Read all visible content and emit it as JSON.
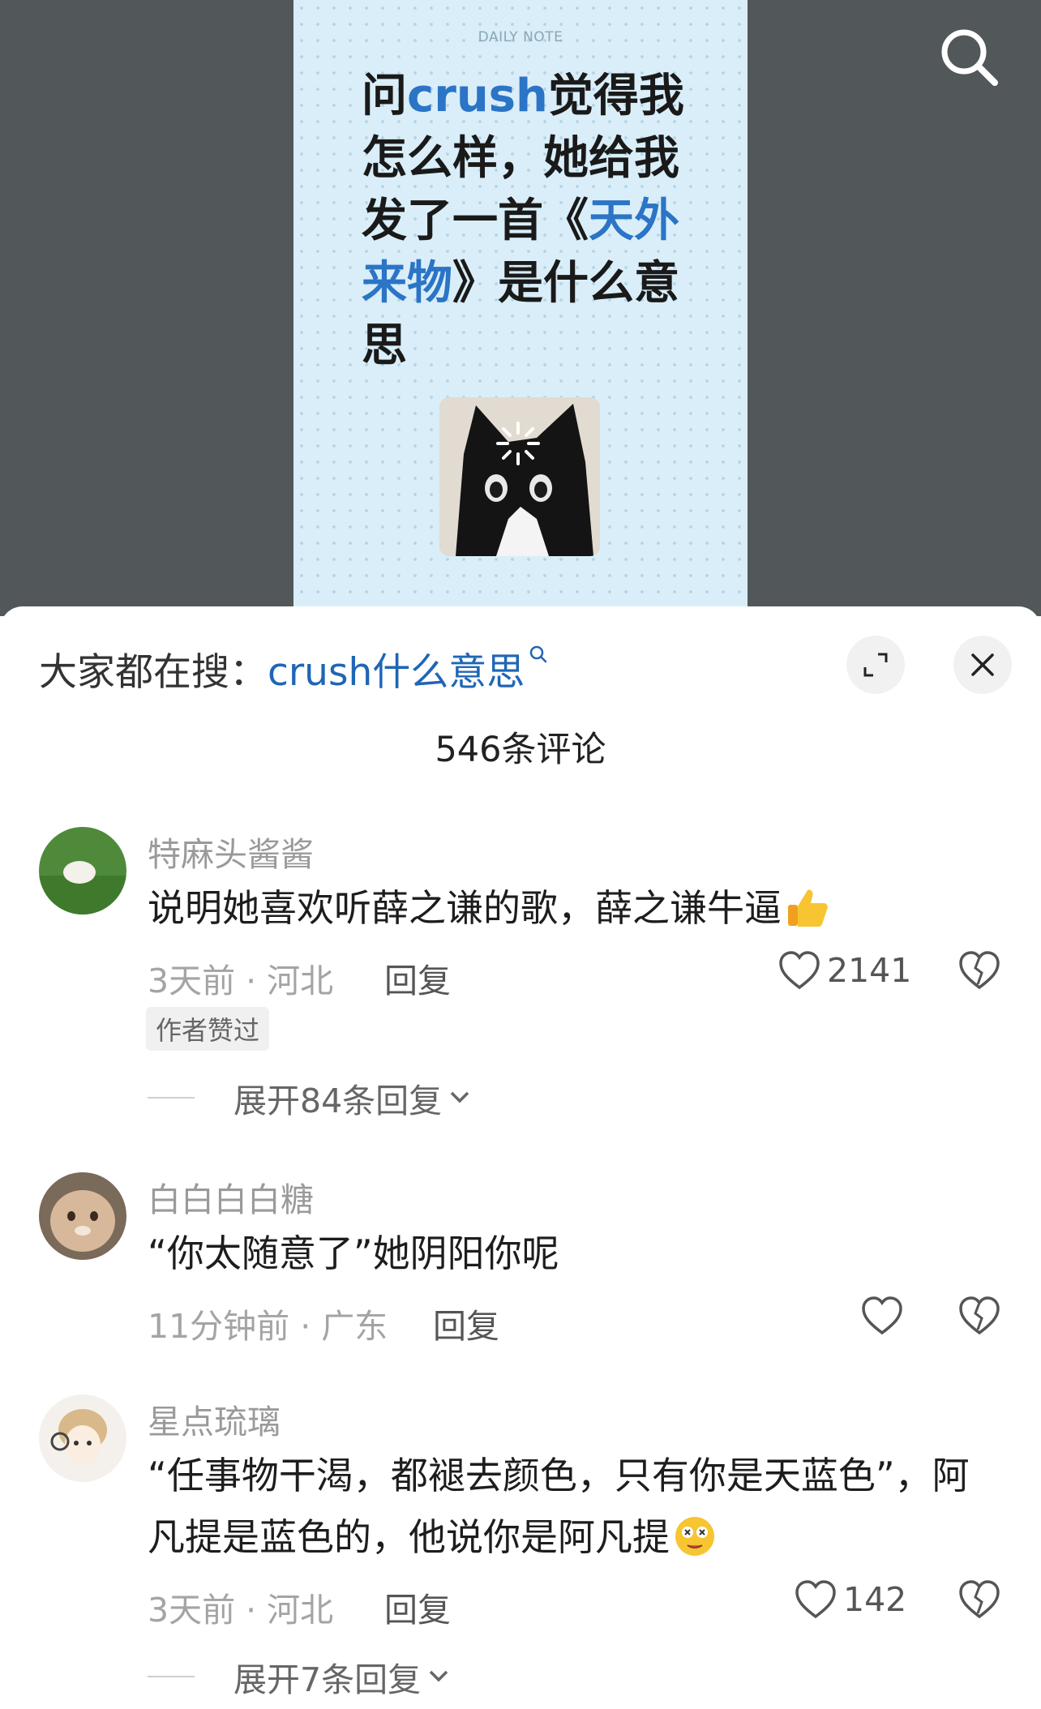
{
  "post": {
    "tag": "DAILY NOTE",
    "title_parts": [
      {
        "text": "问",
        "hl": false
      },
      {
        "text": "crush",
        "hl": true
      },
      {
        "text": "觉得我怎么样，她给我发了一首《",
        "hl": false
      },
      {
        "text": "天外来物",
        "hl": true
      },
      {
        "text": "》是什么意思",
        "hl": false
      }
    ]
  },
  "sheet": {
    "trend_prefix": "大家都在搜：",
    "trend_query": "crush什么意思",
    "comment_count": "546条评论"
  },
  "comments": [
    {
      "user": "特麻头酱酱",
      "text": "说明她喜欢听薛之谦的歌，薛之谦牛逼",
      "emoji": "thumbs-up-emoji",
      "time_location": "3天前 · 河北",
      "reply_label": "回复",
      "likes": "2141",
      "badge": "作者赞过",
      "expand_label": "展开84条回复"
    },
    {
      "user": "白白白白糖",
      "text": "“你太随意了”她阴阳你呢",
      "time_location": "11分钟前 · 广东",
      "reply_label": "回复",
      "likes": ""
    },
    {
      "user": "星点琉璃",
      "text": "“任事物干渴，都褪去颜色，只有你是天蓝色”，阿凡提是蓝色的，他说你是阿凡提",
      "emoji": "dizzy-face-emoji",
      "time_location": "3天前 · 河北",
      "reply_label": "回复",
      "likes": "142",
      "expand_label": "展开7条回复"
    }
  ]
}
